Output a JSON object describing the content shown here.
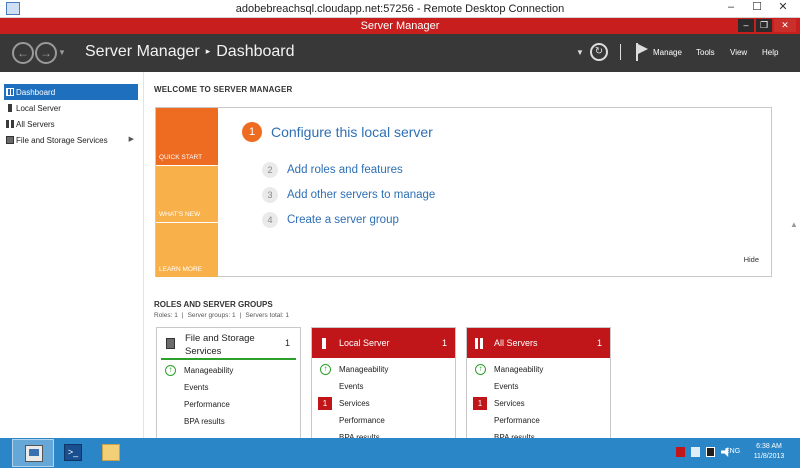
{
  "rdp": {
    "title": "adobebreachsql.cloudapp.net:57256 - Remote Desktop Connection",
    "min": "–",
    "max": "☐",
    "close": "✕"
  },
  "window": {
    "title": "Server Manager",
    "min": "–",
    "max": "❐",
    "close": "✕"
  },
  "header": {
    "app": "Server Manager",
    "page": "Dashboard",
    "menu": [
      "Manage",
      "Tools",
      "View",
      "Help"
    ]
  },
  "sidebar": {
    "items": [
      {
        "label": "Dashboard",
        "icon": "dashboard-icon",
        "active": true
      },
      {
        "label": "Local Server",
        "icon": "server-icon"
      },
      {
        "label": "All Servers",
        "icon": "all-servers-icon"
      },
      {
        "label": "File and Storage Services",
        "icon": "file-storage-icon",
        "expandable": true
      }
    ]
  },
  "welcome": {
    "heading": "WELCOME TO SERVER MANAGER",
    "tiles": [
      "QUICK START",
      "WHAT'S NEW",
      "LEARN MORE"
    ],
    "steps": [
      {
        "num": "1",
        "label": "Configure this local server"
      },
      {
        "num": "2",
        "label": "Add roles and features"
      },
      {
        "num": "3",
        "label": "Add other servers to manage"
      },
      {
        "num": "4",
        "label": "Create a server group"
      }
    ],
    "hide": "Hide"
  },
  "roles": {
    "heading": "ROLES AND SERVER GROUPS",
    "roles_count": "Roles: 1",
    "groups_count": "Server groups: 1",
    "servers_total": "Servers total: 1",
    "sep": "|",
    "cards": [
      {
        "title": "File and Storage Services",
        "count": "1",
        "rows": [
          {
            "label": "Manageability",
            "status": "ok"
          },
          {
            "label": "Events"
          },
          {
            "label": "Performance"
          },
          {
            "label": "BPA results"
          }
        ]
      },
      {
        "title": "Local Server",
        "count": "1",
        "rows": [
          {
            "label": "Manageability",
            "status": "ok"
          },
          {
            "label": "Events"
          },
          {
            "label": "Services",
            "badge": "1"
          },
          {
            "label": "Performance"
          },
          {
            "label": "BPA results"
          }
        ]
      },
      {
        "title": "All Servers",
        "count": "1",
        "rows": [
          {
            "label": "Manageability",
            "status": "ok"
          },
          {
            "label": "Events"
          },
          {
            "label": "Services",
            "badge": "1"
          },
          {
            "label": "Performance"
          },
          {
            "label": "BPA results"
          }
        ]
      }
    ]
  },
  "taskbar": {
    "lang": "ENG",
    "time": "6:38 AM",
    "date": "11/8/2013"
  },
  "colors": {
    "accent_red": "#c0161a",
    "accent_orange": "#ee6b22",
    "accent_light_orange": "#f8b14a",
    "link_blue": "#2e6fb5",
    "taskbar_blue": "#2a86c7"
  }
}
